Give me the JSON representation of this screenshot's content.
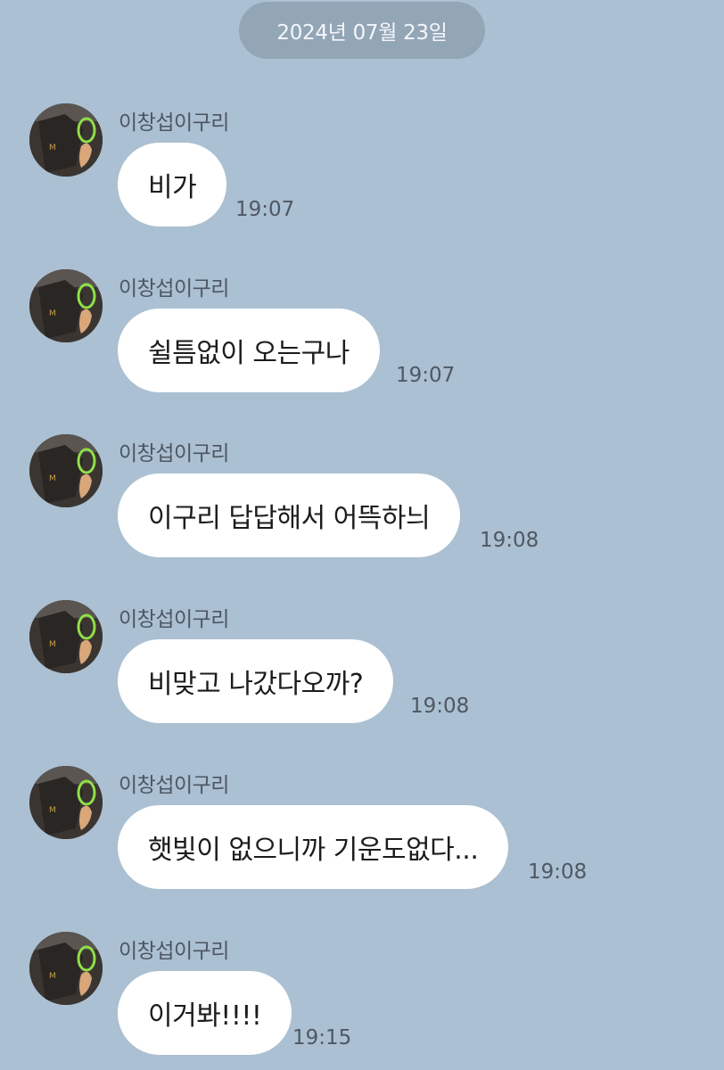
{
  "date_divider": "2024년 07월 23일",
  "messages": [
    {
      "sender": "이창섭이구리",
      "text": "비가",
      "time": "19:07"
    },
    {
      "sender": "이창섭이구리",
      "text": "쉴틈없이 오는구나",
      "time": "19:07"
    },
    {
      "sender": "이창섭이구리",
      "text": "이구리 답답해서 어뜩하늬",
      "time": "19:08"
    },
    {
      "sender": "이창섭이구리",
      "text": "비맞고 나갔다오까?",
      "time": "19:08"
    },
    {
      "sender": "이창섭이구리",
      "text": "햇빛이 없으니까 기운도없다...",
      "time": "19:08"
    },
    {
      "sender": "이창섭이구리",
      "text": "이거봐!!!!",
      "time": "19:15"
    }
  ],
  "colors": {
    "background": "#abc0d2",
    "date_pill": "#93a6b6",
    "bubble": "#ffffff"
  },
  "icons": {
    "avatar": "profile-photo"
  }
}
